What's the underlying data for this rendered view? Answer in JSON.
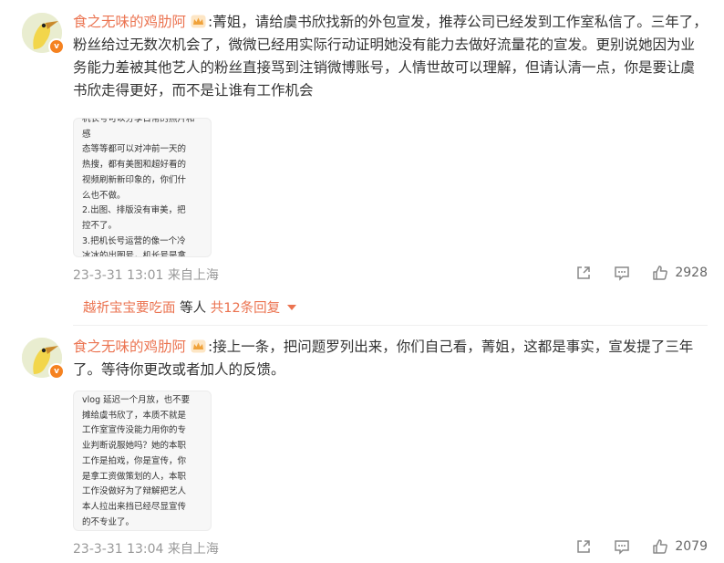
{
  "comments": [
    {
      "user": "食之无味的鸡肋阿",
      "text": ":菁姐，请给虞书欣找新的外包宣发，推荐公司已经发到工作室私信了。三年了，粉丝给过无数次机会了，微微已经用实际行动证明她没有能力去做好流量花的宣发。更别说她因为业务能力差被其他艺人的粉丝直接骂到注销微博账号，人情世故可以理解，但请认清一点，你是要让虞书欣走得更好，而不是让谁有工作机会",
      "image_lines": [
        "机长号可以分享日常的照片和感",
        "态等等都可以对冲前一天的",
        "热搜，都有美图和超好看的",
        "视频刷新新印象的，你们什",
        "么也不做。",
        "2.出图、排版没有审美，把",
        "控不了。",
        "3.把机长号运营的像一个冷",
        "冰冰的出图号，机长号是拿"
      ],
      "date": "23-3-31 13:01",
      "location": "来自上海",
      "likes": "2928",
      "reply_user": "越祈宝宝要吃面",
      "reply_mid": "等人",
      "reply_count": "共12条回复"
    },
    {
      "user": "食之无味的鸡肋阿",
      "text": ":接上一条，把问题罗列出来，你们自己看，菁姐，这都是事实，宣发提了三年了。等待你更改或者加人的反馈。",
      "image_lines": [
        "vlog 延迟一个月放，也不要",
        "摊给虞书欣了，本质不就是",
        "工作室宣传没能力用你的专",
        "业判断说服她吗？她的本职",
        "工作是拍戏，你是宣传，你",
        "是拿工资做策划的人，本职",
        "工作没做好为了辩解把艺人",
        "本人拉出来挡已经尽显宣传",
        "的不专业了。"
      ],
      "date": "23-3-31 13:04",
      "location": "来自上海",
      "likes": "2079"
    }
  ],
  "colors": {
    "username": "#eb7350",
    "badge": "#f58220",
    "meta": "#999999"
  },
  "icons": [
    "avatar-duck",
    "v-badge",
    "crown-icon",
    "share-icon",
    "comment-icon",
    "like-icon",
    "caret-down-icon"
  ]
}
